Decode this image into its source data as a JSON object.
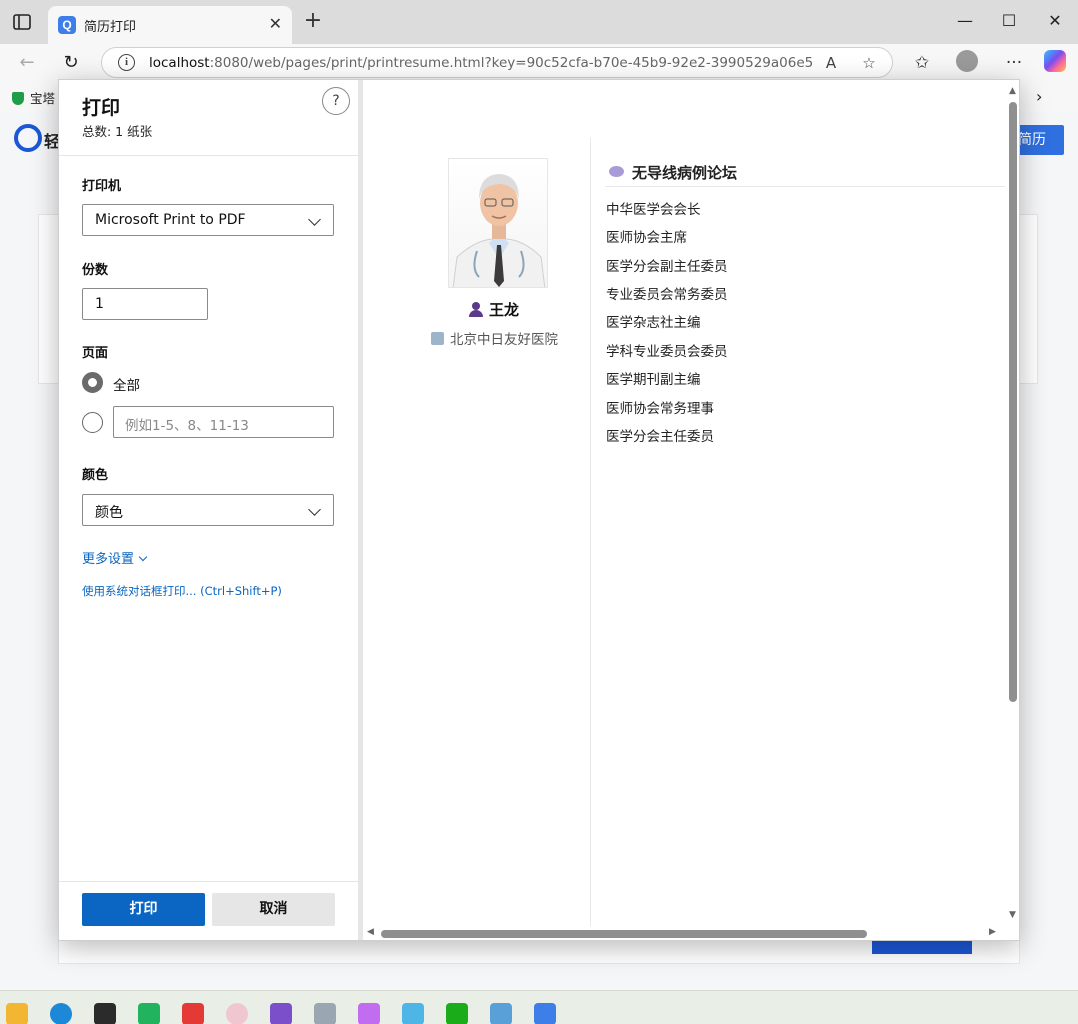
{
  "browser": {
    "tab_title": "简历打印",
    "tab_favicon": "Q",
    "url_host": "localhost",
    "url_rest": ":8080/web/pages/print/printresume.html?key=90c52cfa-b70e-45b9-92e2-3990529a06e5",
    "bookmark": "宝塔"
  },
  "background_page": {
    "logo_text": "轻",
    "action_button": "简历"
  },
  "print_panel": {
    "title": "打印",
    "total": "总数: 1 纸张",
    "help": "?",
    "printer_label": "打印机",
    "printer_value": "Microsoft Print to PDF",
    "copies_label": "份数",
    "copies_value": "1",
    "pages_label": "页面",
    "pages_all": "全部",
    "pages_range_placeholder": "例如1-5、8、11-13",
    "color_label": "颜色",
    "color_value": "颜色",
    "more_settings": "更多设置",
    "system_dialog": "使用系统对话框打印... (Ctrl+Shift+P)",
    "print_button": "打印",
    "cancel_button": "取消"
  },
  "resume": {
    "name": "王龙",
    "hospital": "北京中日友好医院",
    "forum_title": "无导线病例论坛",
    "roles": [
      "中华医学会会长",
      "医师协会主席",
      "医学分会副主任委员",
      "专业委员会常务委员",
      "医学杂志社主编",
      "学科专业委员会委员",
      "医学期刊副主编",
      "医师协会常务理事",
      "医学分会主任委员"
    ]
  },
  "colors": {
    "accent": "#0a66c2",
    "name_icon": "#5b3a8c"
  }
}
